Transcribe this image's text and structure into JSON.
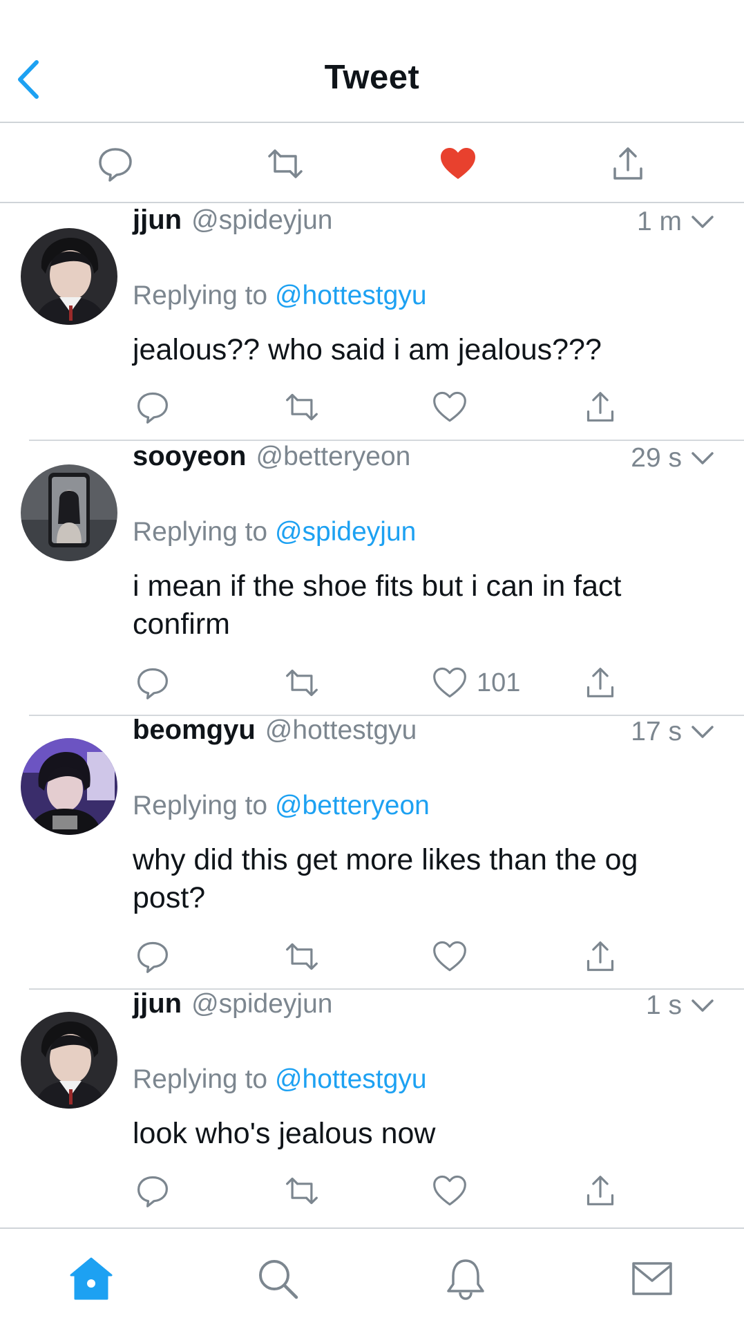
{
  "header": {
    "title": "Tweet"
  },
  "colors": {
    "accent": "#1da1f2",
    "like_red": "#e0245e",
    "muted": "#7c868f"
  },
  "main_actions": [
    "reply-icon",
    "retweet-icon",
    "heart-filled-icon",
    "share-icon"
  ],
  "tweets": [
    {
      "name": "jjun",
      "handle": "@spideyjun",
      "time": "1 m",
      "reply_prefix": "Replying to",
      "reply_to": "@hottestgyu",
      "text": "jealous?? who said i am jealous???",
      "likes": ""
    },
    {
      "name": "sooyeon",
      "handle": "@betteryeon",
      "time": "29 s",
      "reply_prefix": "Replying to",
      "reply_to": "@spideyjun",
      "text": "i mean if the shoe fits but i can in fact confirm",
      "likes": "101"
    },
    {
      "name": "beomgyu",
      "handle": "@hottestgyu",
      "time": "17 s",
      "reply_prefix": "Replying to",
      "reply_to": "@betteryeon",
      "text": "why did this get more likes than the og post?",
      "likes": ""
    },
    {
      "name": "jjun",
      "handle": "@spideyjun",
      "time": "1 s",
      "reply_prefix": "Replying to",
      "reply_to": "@hottestgyu",
      "text": "look who's jealous now",
      "likes": ""
    }
  ],
  "tabbar": [
    "home-icon",
    "search-icon",
    "notifications-bell-icon",
    "messages-envelope-icon"
  ]
}
